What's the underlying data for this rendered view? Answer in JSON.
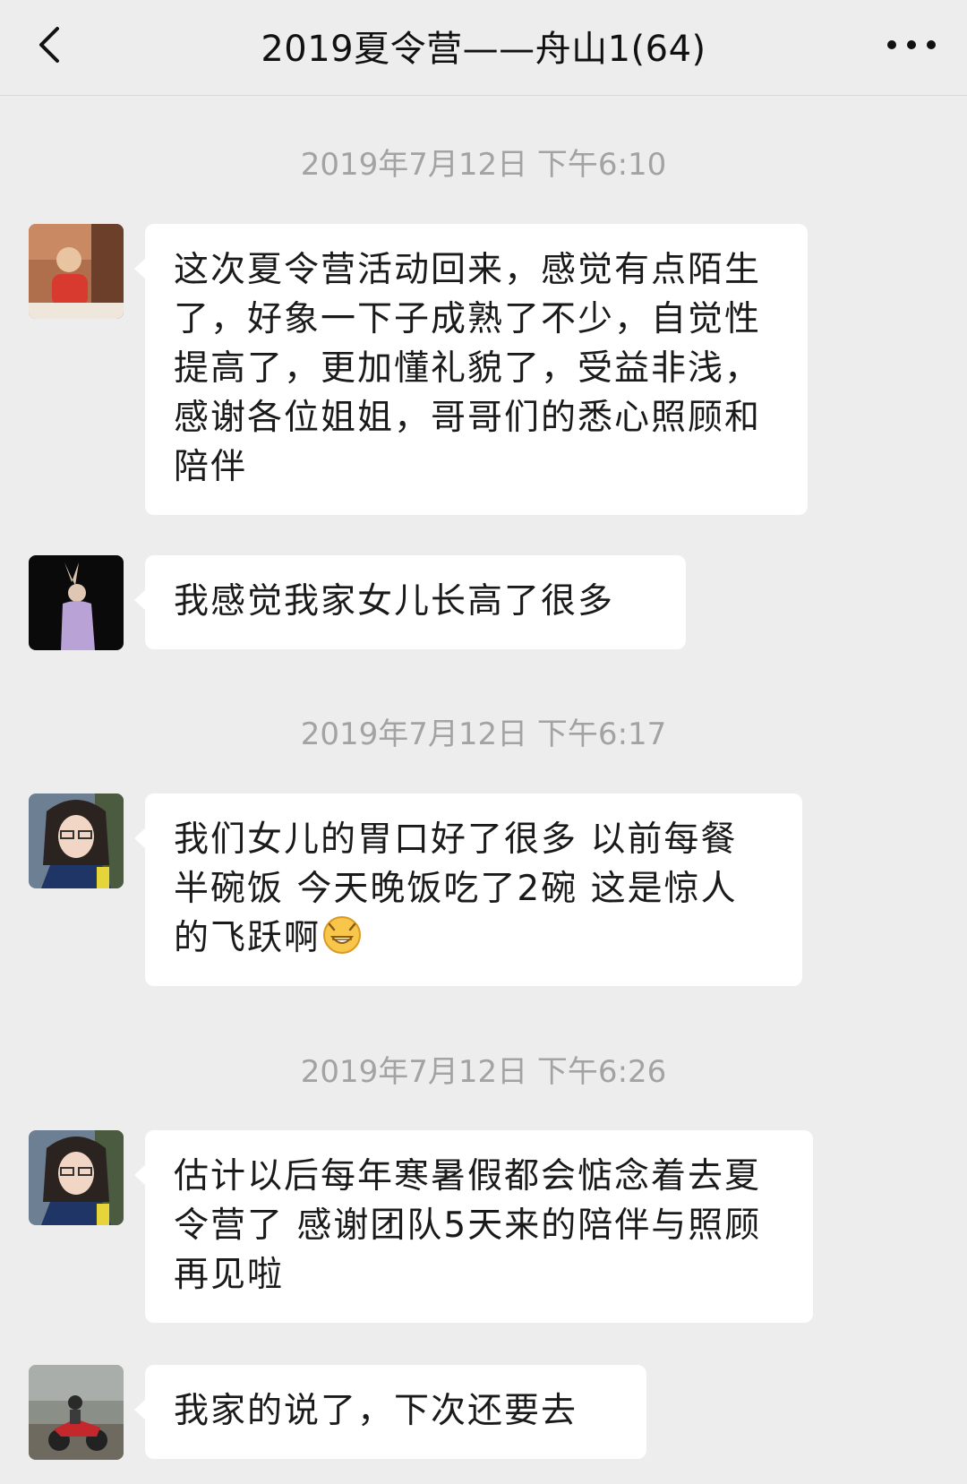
{
  "nav": {
    "title": "2019夏令营——舟山1(64)",
    "back_icon": "chevron-left-icon",
    "more_icon": "more-dots-icon"
  },
  "messages": [
    {
      "timestamp": "2019年7月12日 下午6:10"
    },
    {
      "text": "这次夏令营活动回来，感觉有点陌生了，好象一下子成熟了不少，自觉性提高了，更加懂礼貌了，受益非浅，感谢各位姐姐，哥哥们的悉心照顾和陪伴"
    },
    {
      "text": "我感觉我家女儿长高了很多"
    },
    {
      "timestamp": "2019年7月12日 下午6:17"
    },
    {
      "text": "我们女儿的胃口好了很多  以前每餐半碗饭  今天晚饭吃了2碗   这是惊人的飞跃啊",
      "emoji": "grinning-face-icon"
    },
    {
      "timestamp": "2019年7月12日 下午6:26"
    },
    {
      "text": "估计以后每年寒暑假都会惦念着去夏令营了  感谢团队5天来的陪伴与照顾  再见啦"
    },
    {
      "text": "我家的说了，下次还要去"
    }
  ],
  "colors": {
    "background": "#ededed",
    "bubble": "#ffffff",
    "timestamp": "#a3a3a3",
    "text": "#1a1a1a"
  }
}
